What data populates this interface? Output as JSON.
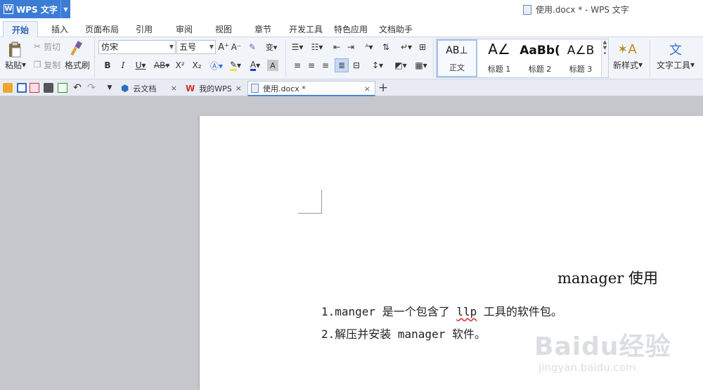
{
  "app": {
    "name": "WPS 文字",
    "logo": "W",
    "window_title": "使用.docx * - WPS 文字"
  },
  "ribbon_tabs": [
    "开始",
    "插入",
    "页面布局",
    "引用",
    "审阅",
    "视图",
    "章节",
    "开发工具",
    "特色应用",
    "文档助手"
  ],
  "active_tab": "开始",
  "clipboard": {
    "paste": "粘贴",
    "cut": "剪切",
    "copy": "复制",
    "format_painter": "格式刷"
  },
  "font": {
    "family": "仿宋",
    "size": "五号"
  },
  "format_buttons": {
    "bold": "B",
    "italic": "I",
    "underline": "U",
    "strike": "AB",
    "superscript": "X²",
    "subscript": "X₂"
  },
  "styles": [
    {
      "preview": "A⁢B⊥",
      "label": "正文"
    },
    {
      "preview": "A∠",
      "label": "标题 1"
    },
    {
      "preview": "AaBb(",
      "label": "标题 2"
    },
    {
      "preview": "A∠B",
      "label": "标题 3"
    }
  ],
  "new_style": "新样式",
  "text_tools": "文字工具",
  "doc_tabs": [
    {
      "label": "云文档",
      "icon": "cloud-doc-icon"
    },
    {
      "label": "我的WPS",
      "icon": "wps-logo-icon"
    },
    {
      "label": "使用.docx *",
      "icon": "document-icon"
    }
  ],
  "document": {
    "heading": "manager 使用",
    "lines": [
      {
        "prefix": "1.manger 是一个包含了 ",
        "flagged": "llp",
        "suffix": " 工具的软件包。"
      },
      {
        "prefix": "2.解压并安装 manager 软件。",
        "flagged": "",
        "suffix": ""
      }
    ]
  },
  "watermark": {
    "main": "Baidu经验",
    "sub": "jingyan.baidu.com"
  },
  "colors": {
    "accent": "#3c7cd4",
    "font_color": "#1f3fbf",
    "highlight": "#f0e040"
  }
}
